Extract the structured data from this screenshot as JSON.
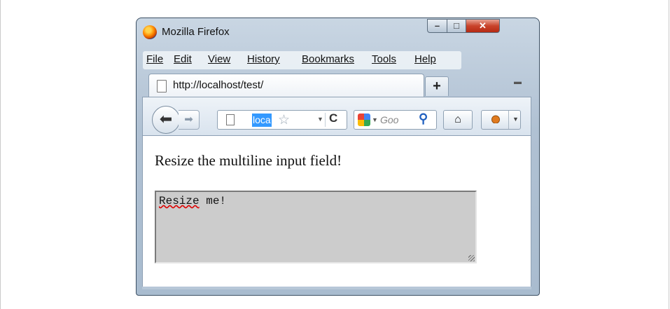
{
  "window": {
    "title": "Mozilla Firefox",
    "controls": {
      "minimize": "–",
      "maximize": "□",
      "close": "✕"
    }
  },
  "menubar": {
    "items": [
      {
        "label": "File"
      },
      {
        "label": "Edit"
      },
      {
        "label": "View"
      },
      {
        "label": "History"
      },
      {
        "label": "Bookmarks"
      },
      {
        "label": "Tools"
      },
      {
        "label": "Help"
      }
    ]
  },
  "tabs": {
    "active_label": "http://localhost/test/",
    "new_tab": "+"
  },
  "navbar": {
    "url_text": "loca",
    "search_placeholder": "Goo",
    "icons": [
      "back-arrow-icon",
      "forward-arrow-icon",
      "page-icon",
      "star-icon",
      "reload-icon",
      "google-icon",
      "magnifier-icon",
      "home-icon",
      "firebug-icon"
    ]
  },
  "page": {
    "heading": "Resize the multiline input field!",
    "textarea_word1": "Resize",
    "textarea_word2": " me!"
  },
  "colors": {
    "selection": "#3399ff",
    "textarea_bg": "#cccccc",
    "close_button": "#c9432a"
  }
}
